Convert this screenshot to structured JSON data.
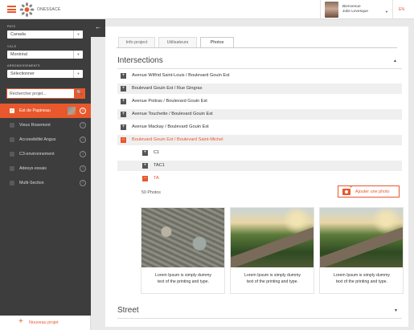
{
  "header": {
    "brand": "ONESSACE",
    "greeting_line1": "Bienvenue",
    "greeting_line2": "Julie Levesque",
    "user_caret": "▼",
    "language": "EN"
  },
  "sidebar": {
    "pays_label": "PAYS",
    "pays_value": "Canada",
    "ville_label": "VILLE",
    "ville_value": "Montréal",
    "arr_label": "ARRONDISSEMENTS",
    "arr_value": "Sélectionner",
    "search_value": "Rechercher projet...",
    "search_icon": "🔍",
    "select_caret": "▼",
    "projects": [
      {
        "label": "Est de Papineau",
        "active": true
      },
      {
        "label": "Vieux Rosemont",
        "active": false
      },
      {
        "label": "Accessibilité Angus",
        "active": false
      },
      {
        "label": "C3-environnement",
        "active": false
      },
      {
        "label": "Adesys essais",
        "active": false
      },
      {
        "label": "Multi-Section",
        "active": false
      }
    ],
    "info_glyph": "i",
    "check_glyph": "✓",
    "new_project_plus": "+",
    "new_project": "Nouveau projet",
    "collapse_glyph": "←"
  },
  "tabs": [
    {
      "label": "Info project"
    },
    {
      "label": "Utilisateurs"
    },
    {
      "label": "Photos"
    }
  ],
  "section": {
    "title": "Intersections",
    "caret": "▲",
    "plus": "+",
    "minus": "−",
    "rows": [
      "Avenue Wilfrid Saint-Louis / Boulevard Gouin Est",
      "Boulevard Gouin Est / Rue Gingras",
      "Avenue Poitras / Boulevard Gouin Est",
      "Avenue Touchette / Boulevard Gouin Est",
      "Avenue Mackay / Boulevard Gouin Est",
      "Boulevard Gouin Est / Boulevard Saint-Michel"
    ],
    "subrows": [
      "C1",
      "TAC1",
      "TA"
    ]
  },
  "photos": {
    "count": "50 Photos",
    "add_plus": "+",
    "add_label": "Ajouter une photo",
    "caption_line1": "Lorem Ipsum is simply dummy",
    "caption_line2": "text of the printing and type."
  },
  "street": {
    "title": "Street",
    "caret": "▼"
  },
  "colors": {
    "accent": "#e8582c",
    "sidebar": "#3d3d3d"
  }
}
